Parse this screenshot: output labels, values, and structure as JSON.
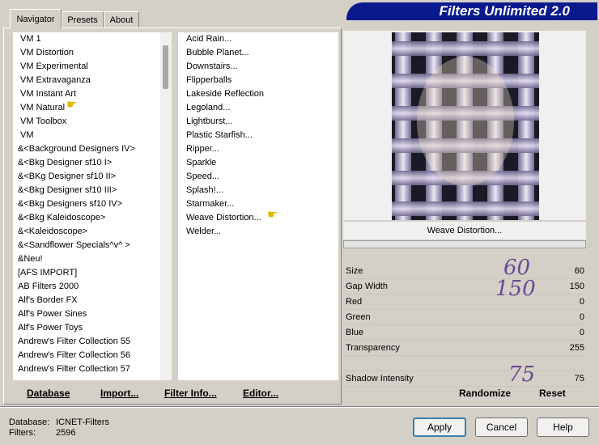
{
  "tabs": [
    {
      "label": "Navigator",
      "active": true
    },
    {
      "label": "Presets",
      "active": false
    },
    {
      "label": "About",
      "active": false
    }
  ],
  "banner": {
    "title": "Filters Unlimited 2.0"
  },
  "categories": [
    "VM 1",
    "VM Distortion",
    "VM Experimental",
    "VM Extravaganza",
    "VM Instant Art",
    "VM Natural",
    "VM Toolbox",
    "VM",
    "&<Background Designers IV>",
    "&<Bkg Designer sf10 I>",
    "&<BKg Designer sf10 II>",
    "&<Bkg Designer sf10 III>",
    "&<Bkg Designers sf10 IV>",
    "&<Bkg Kaleidoscope>",
    "&<Kaleidoscope>",
    "&<Sandflower Specials^v^ >",
    "&Neu!",
    "[AFS IMPORT]",
    "AB Filters 2000",
    "Alf's Border FX",
    "Alf's Power Sines",
    "Alf's Power Toys",
    "Andrew's Filter Collection 55",
    "Andrew's Filter Collection 56",
    "Andrew's Filter Collection 57"
  ],
  "filters": [
    "Acid Rain...",
    "Bubble Planet...",
    "Downstairs...",
    "Flipperballs",
    "Lakeside Reflection",
    "Legoland...",
    "Lightburst...",
    "Plastic Starfish...",
    "Ripper...",
    "Sparkle",
    "Speed...",
    "Splash!...",
    "Starmaker...",
    "Weave Distortion...",
    "Welder..."
  ],
  "preview": {
    "filter_name": "Weave Distortion...",
    "colors": {
      "dark": "#1a1a26",
      "light": "#d8d0e8",
      "accent": "#8a6a9a"
    }
  },
  "params": [
    {
      "label": "Size",
      "value": "60"
    },
    {
      "label": "Gap Width",
      "value": "150"
    },
    {
      "label": "Red",
      "value": "0"
    },
    {
      "label": "Green",
      "value": "0"
    },
    {
      "label": "Blue",
      "value": "0"
    },
    {
      "label": "Transparency",
      "value": "255"
    },
    {
      "label": "",
      "value": ""
    },
    {
      "label": "Shadow Intensity",
      "value": "75"
    }
  ],
  "annotations": {
    "size": "60",
    "gap": "150",
    "shadow": "75"
  },
  "left_buttons": {
    "database": "Database",
    "import": "Import...",
    "filter_info": "Filter Info...",
    "editor": "Editor..."
  },
  "right_buttons": {
    "randomize": "Randomize",
    "reset": "Reset"
  },
  "status": {
    "database_label": "Database:",
    "database_value": "ICNET-Filters",
    "filters_label": "Filters:",
    "filters_value": "2596"
  },
  "dialog": {
    "apply": "Apply",
    "cancel": "Cancel",
    "help": "Help"
  },
  "icons": {
    "pointer": "pointing-hand-icon"
  }
}
